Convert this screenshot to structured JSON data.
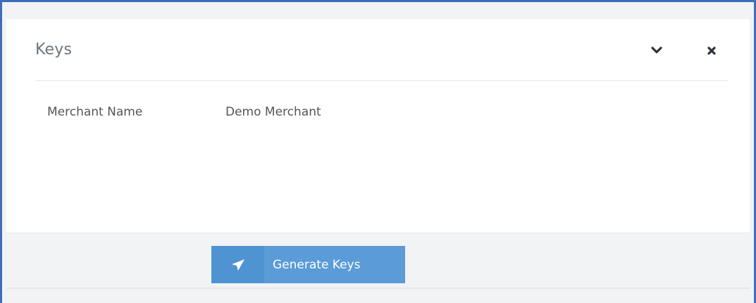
{
  "panel": {
    "title": "Keys",
    "collapse_icon": "chevron-down-icon",
    "close_icon": "close-icon"
  },
  "fields": [
    {
      "label": "Merchant Name",
      "value": "Demo Merchant"
    }
  ],
  "footer": {
    "generate_button_label": "Generate Keys",
    "generate_button_icon": "paper-plane-icon"
  },
  "colors": {
    "frame_border": "#3d6fb6",
    "button_bg": "#5a9bd8",
    "button_icon_bg": "#4f93d3",
    "footer_bg": "#f2f3f5",
    "title_text": "#6c757d",
    "body_text": "#555555"
  }
}
